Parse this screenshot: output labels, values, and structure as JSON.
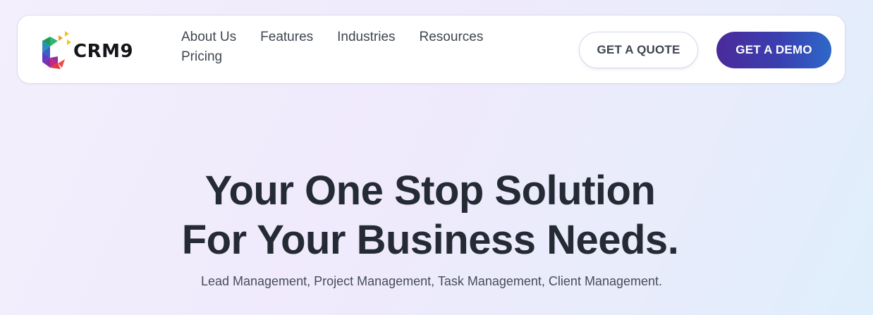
{
  "brand": {
    "name": "CRM9"
  },
  "nav": {
    "links": [
      "About Us",
      "Features",
      "Industries",
      "Resources",
      "Pricing"
    ]
  },
  "actions": {
    "quote_label": "GET A QUOTE",
    "demo_label": "GET A DEMO"
  },
  "hero": {
    "title_line1": "Your One Stop Solution",
    "title_line2": "For Your Business Needs.",
    "subtitle": "Lead Management, Project Management, Task Management, Client Management."
  },
  "colors": {
    "demo_gradient_start": "#4b2a9a",
    "demo_gradient_end": "#2e68c9",
    "heading": "#252b35"
  }
}
